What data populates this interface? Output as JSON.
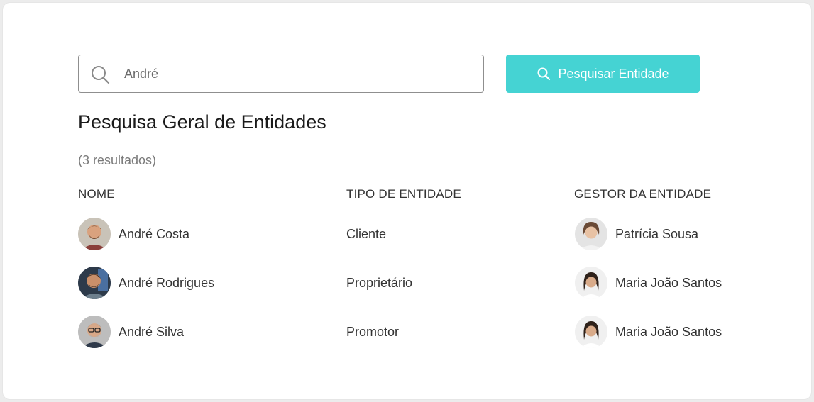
{
  "search": {
    "value": "André",
    "placeholder": "",
    "button_label": "Pesquisar Entidade"
  },
  "page": {
    "title": "Pesquisa Geral de Entidades",
    "result_count": "(3 resultados)"
  },
  "table": {
    "headers": {
      "name": "NOME",
      "type": "TIPO DE ENTIDADE",
      "manager": "GESTOR DA ENTIDADE"
    },
    "rows": [
      {
        "name": "André Costa",
        "type": "Cliente",
        "manager": "Patrícia Sousa"
      },
      {
        "name": "André Rodrigues",
        "type": "Proprietário",
        "manager": "Maria João Santos"
      },
      {
        "name": "André Silva",
        "type": "Promotor",
        "manager": "Maria João Santos"
      }
    ]
  },
  "colors": {
    "accent": "#45d3d3",
    "text": "#333333",
    "muted": "#7a7a7a"
  }
}
